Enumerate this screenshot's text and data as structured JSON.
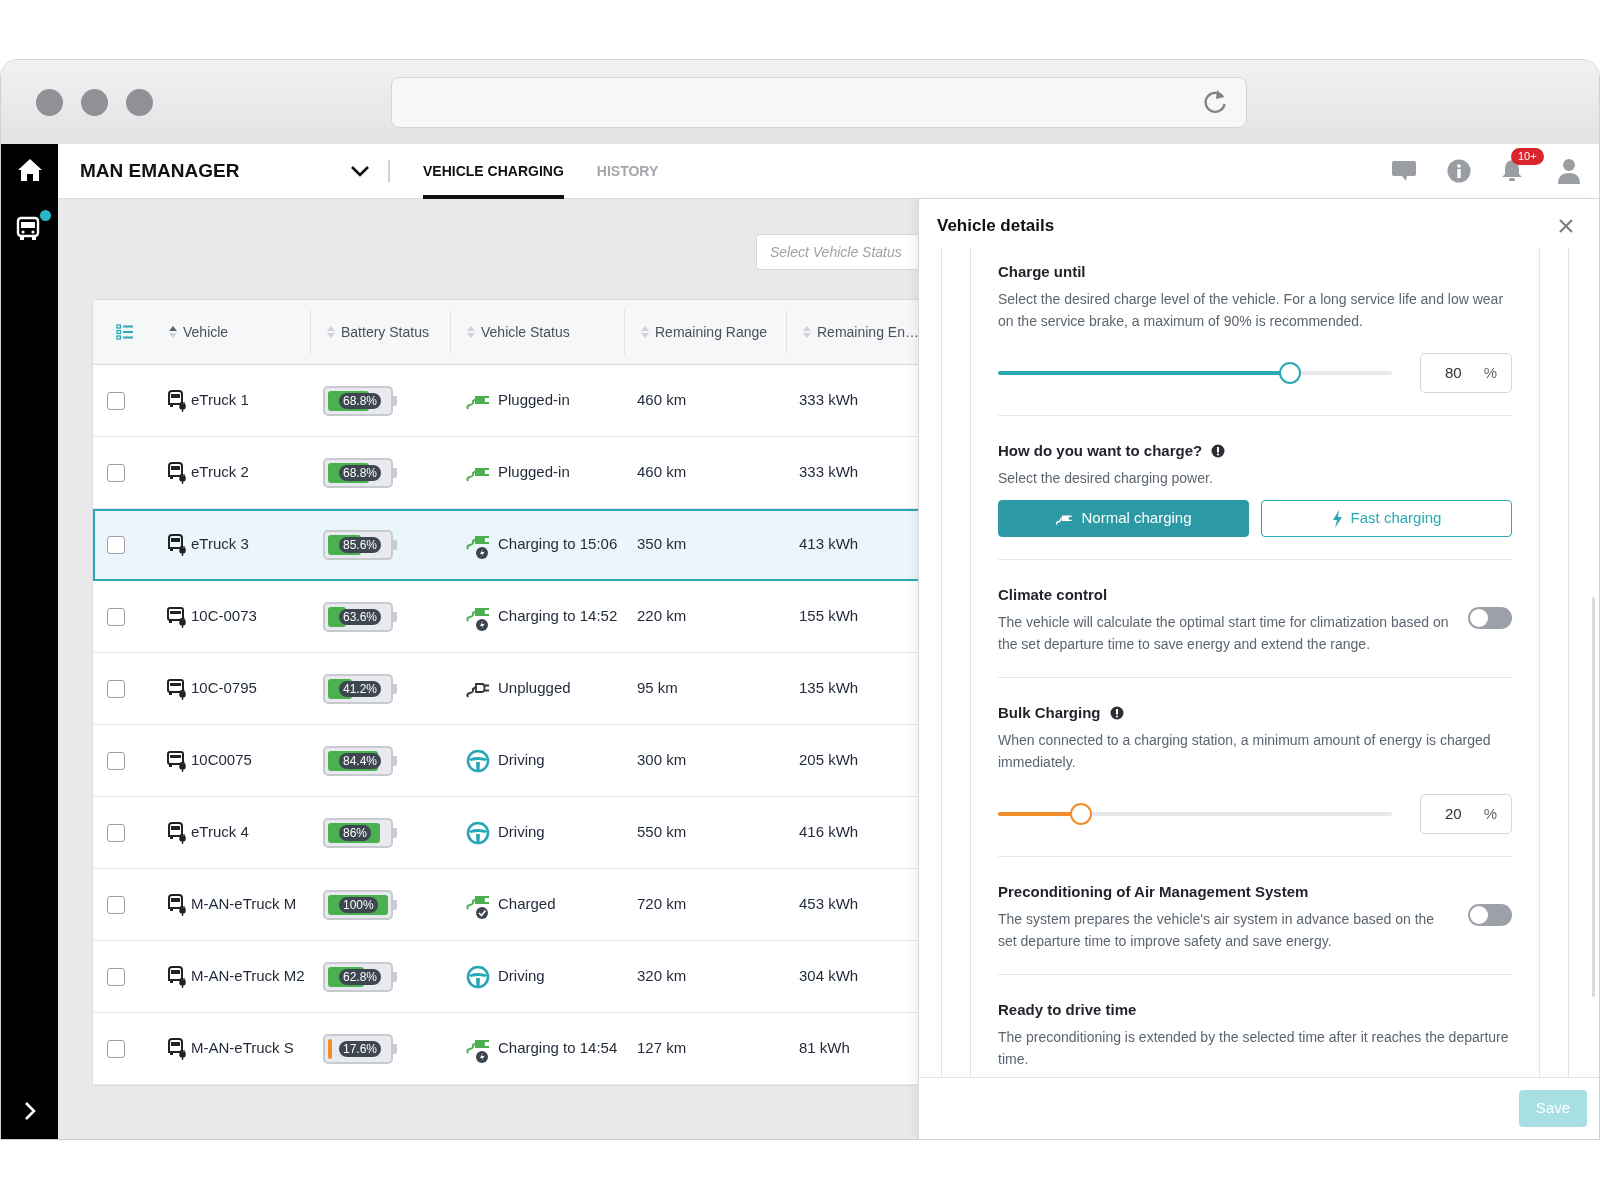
{
  "sidebar": {
    "items": [
      {
        "kind": "home",
        "badge": false
      },
      {
        "kind": "bus",
        "badge": true
      }
    ]
  },
  "header": {
    "title": "MAN EMANAGER",
    "tabs": [
      {
        "label": "VEHICLE CHARGING",
        "selected": true
      },
      {
        "label": "HISTORY",
        "selected": false
      }
    ],
    "notification_count": "10+"
  },
  "filter": {
    "placeholder": "Select Vehicle Status"
  },
  "table": {
    "columns": [
      {
        "label": "Vehicle",
        "sorted": true
      },
      {
        "label": "Battery Status",
        "sorted": false
      },
      {
        "label": "Vehicle Status",
        "sorted": false
      },
      {
        "label": "Remaining Range",
        "sorted": false
      },
      {
        "label": "Remaining En…",
        "sorted": false
      }
    ],
    "rows": [
      {
        "vehicle": {
          "name": "eTruck 1",
          "kind": "truck"
        },
        "battery": "68.8%",
        "level": 0.688,
        "color": "#4caf50",
        "status": {
          "label": "Plugged-in",
          "kind": "plugged"
        },
        "range": "460 km",
        "energy": "333 kWh",
        "checked": false,
        "selected": false
      },
      {
        "vehicle": {
          "name": "eTruck 2",
          "kind": "truck"
        },
        "battery": "68.8%",
        "level": 0.688,
        "color": "#4caf50",
        "status": {
          "label": "Plugged-in",
          "kind": "plugged"
        },
        "range": "460 km",
        "energy": "333 kWh",
        "checked": false,
        "selected": false
      },
      {
        "vehicle": {
          "name": "eTruck 3",
          "kind": "truck"
        },
        "battery": "85.6%",
        "level": 0.556,
        "color": "#4caf50",
        "status": {
          "label": "Charging to 15:06",
          "kind": "charging"
        },
        "range": "350 km",
        "energy": "413 kWh",
        "checked": false,
        "selected": true
      },
      {
        "vehicle": {
          "name": "10C-0073",
          "kind": "bus"
        },
        "battery": "63.6%",
        "level": 0.3,
        "color": "#4caf50",
        "status": {
          "label": "Charging to 14:52",
          "kind": "charging"
        },
        "range": "220 km",
        "energy": "155 kWh",
        "checked": false,
        "selected": false
      },
      {
        "vehicle": {
          "name": "10C-0795",
          "kind": "bus"
        },
        "battery": "41.2%",
        "level": 0.4,
        "color": "#4caf50",
        "status": {
          "label": "Unplugged",
          "kind": "unplugged"
        },
        "range": "95 km",
        "energy": "135 kWh",
        "checked": false,
        "selected": false
      },
      {
        "vehicle": {
          "name": "10C0075",
          "kind": "bus"
        },
        "battery": "84.4%",
        "level": 0.84,
        "color": "#4caf50",
        "status": {
          "label": "Driving",
          "kind": "driving"
        },
        "range": "300 km",
        "energy": "205 kWh",
        "checked": false,
        "selected": false
      },
      {
        "vehicle": {
          "name": "eTruck 4",
          "kind": "truck"
        },
        "battery": "86%",
        "level": 0.86,
        "color": "#4caf50",
        "status": {
          "label": "Driving",
          "kind": "driving"
        },
        "range": "550 km",
        "energy": "416 kWh",
        "checked": false,
        "selected": false
      },
      {
        "vehicle": {
          "name": "M-AN-eTruck M",
          "kind": "truck"
        },
        "battery": "100%",
        "level": 1,
        "color": "#4caf50",
        "status": {
          "label": "Charged",
          "kind": "charged"
        },
        "range": "720 km",
        "energy": "453 kWh",
        "checked": false,
        "selected": false
      },
      {
        "vehicle": {
          "name": "M-AN-eTruck M2",
          "kind": "truck"
        },
        "battery": "62.8%",
        "level": 0.6,
        "color": "#4caf50",
        "status": {
          "label": "Driving",
          "kind": "driving"
        },
        "range": "320 km",
        "energy": "304 kWh",
        "checked": false,
        "selected": false
      },
      {
        "vehicle": {
          "name": "M-AN-eTruck S",
          "kind": "truck"
        },
        "battery": "17.6%",
        "level": 0.06,
        "color": "#f28c28",
        "status": {
          "label": "Charging to 14:54",
          "kind": "charging"
        },
        "range": "127 km",
        "energy": "81 kWh",
        "checked": false,
        "selected": false
      }
    ]
  },
  "panel": {
    "title": "Vehicle details",
    "sections": [
      {
        "kind": "slider",
        "title": "Charge until",
        "info": false,
        "text": "Select the desired charge level of the vehicle. For a long service life and low wear on the service brake, a maximum of 90% is recommended.",
        "level": 0.74,
        "color": "#2aa8b4",
        "value": "80",
        "unit": "%"
      },
      {
        "kind": "choice",
        "title": "How do you want to charge?",
        "info": true,
        "text": "Select the desired charging power.",
        "options": [
          {
            "label": "Normal charging",
            "kind": "plug",
            "selected": true
          },
          {
            "label": "Fast charging",
            "kind": "bolt",
            "selected": false
          }
        ]
      },
      {
        "kind": "toggle",
        "title": "Climate control",
        "info": false,
        "text": "The vehicle will calculate the optimal start time for climatization based on the set departure time to save energy and extend the range.",
        "on": false
      },
      {
        "kind": "slider",
        "title": "Bulk Charging",
        "info": true,
        "text": "When connected to a charging station, a minimum amount of energy is charged immediately.",
        "level": 0.21,
        "color": "#f28c28",
        "value": "20",
        "unit": "%"
      },
      {
        "kind": "toggle",
        "title": "Preconditioning of Air Management System",
        "info": false,
        "text": "The system prepares the vehicle's air system in advance based on the set departure time to improve safety and save energy.",
        "on": false
      },
      {
        "kind": "text",
        "title": "Ready to drive time",
        "info": false,
        "text": "The preconditioning is extended by the selected time after it reaches the departure time."
      }
    ],
    "save": {
      "label": "Save",
      "disabled": true
    }
  }
}
